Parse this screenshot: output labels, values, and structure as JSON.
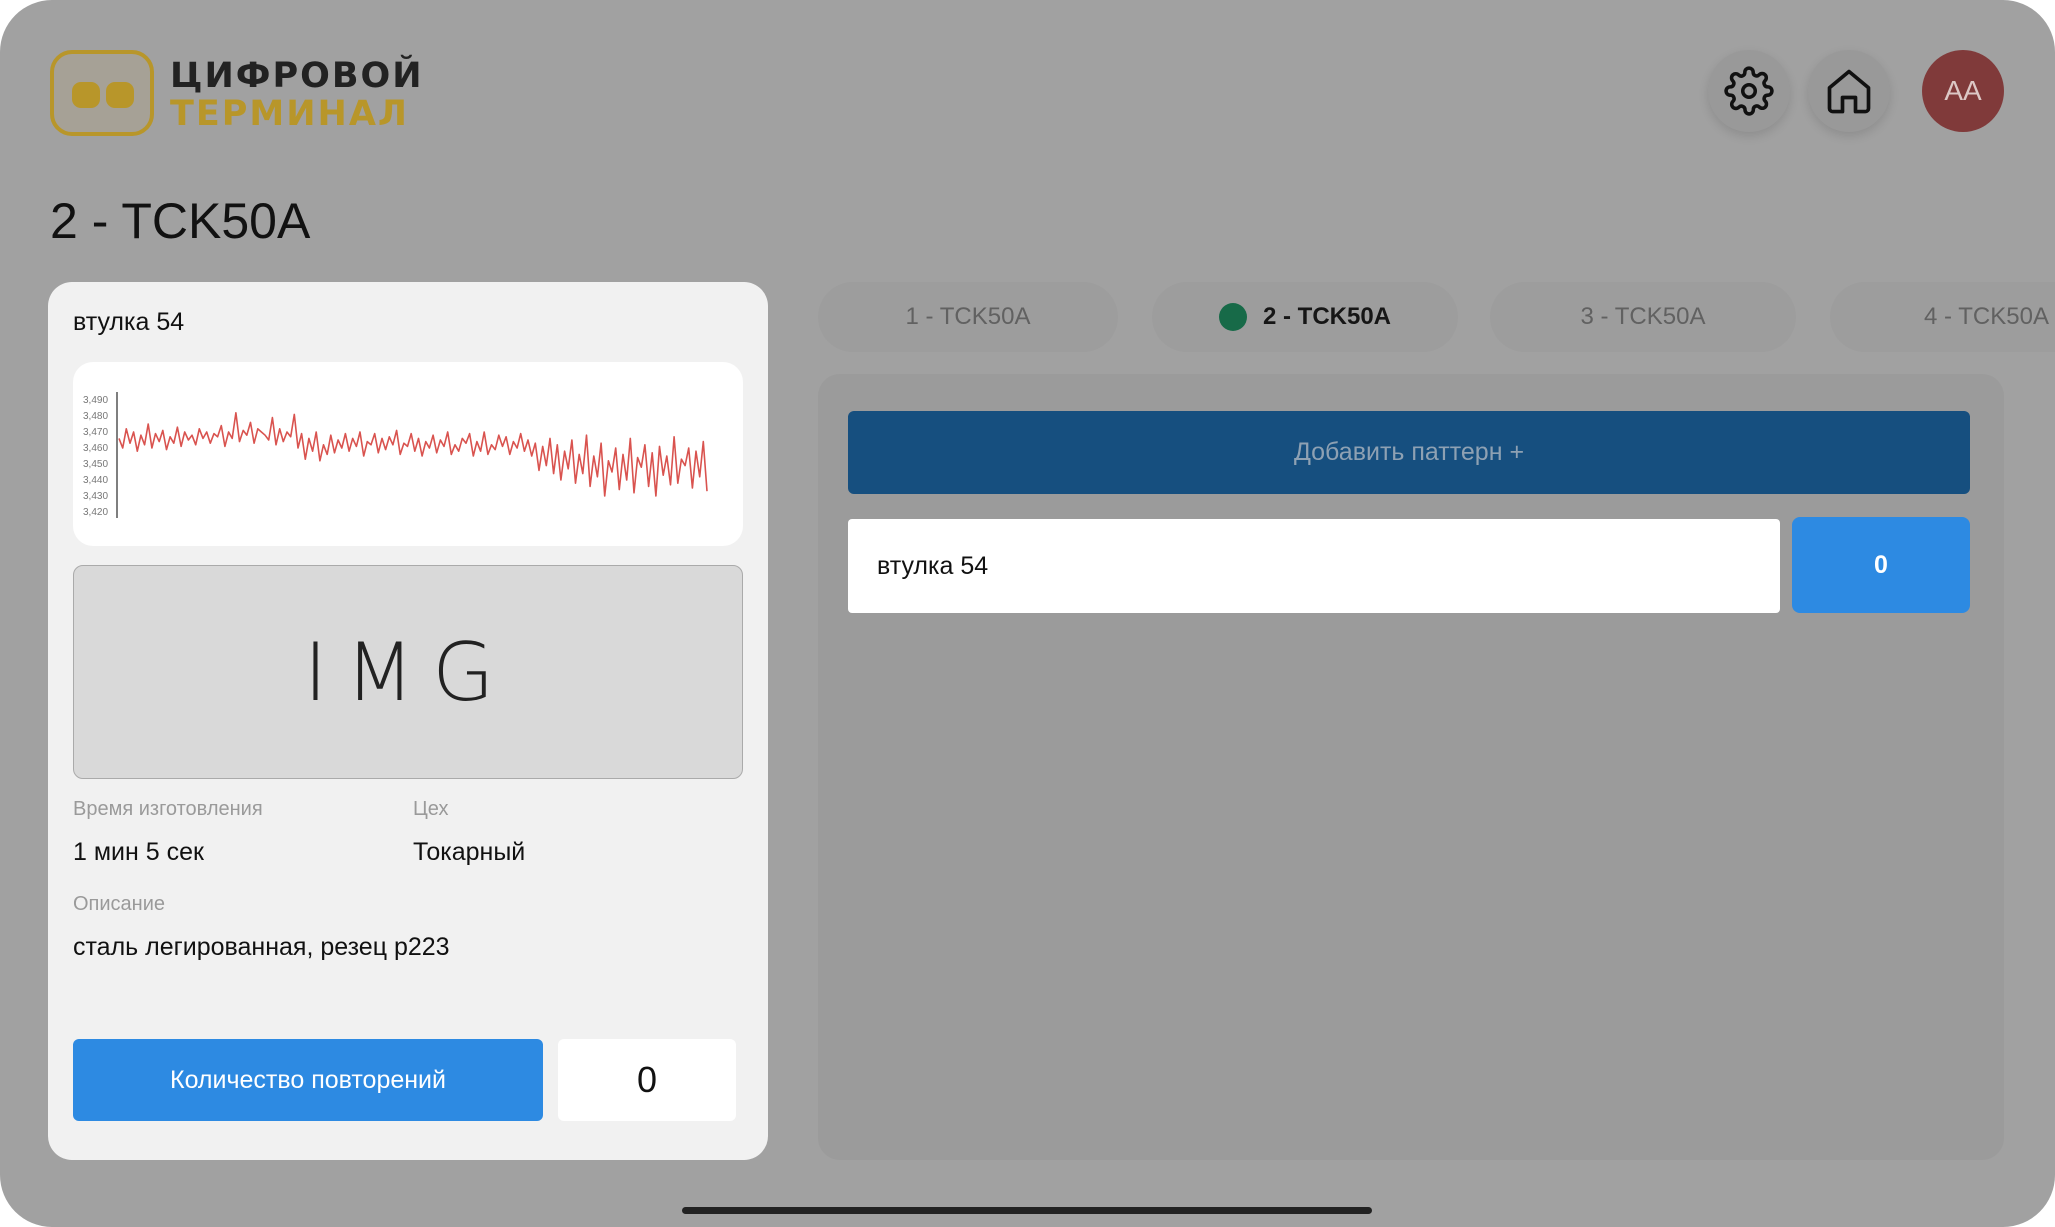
{
  "logo": {
    "line1": "ЦИФРОВОЙ",
    "line2": "ТЕРМИНАЛ"
  },
  "header": {
    "settings_icon": "gear-icon",
    "home_icon": "home-icon",
    "avatar_initials": "AA"
  },
  "page_title": "2 - TCK50A",
  "card": {
    "title": "втулка 54",
    "image_placeholder": "IMG",
    "time_label": "Время изготовления",
    "time_value": "1 мин 5 сек",
    "shop_label": "Цех",
    "shop_value": "Токарный",
    "description_label": "Описание",
    "description_value": "сталь легированная, резец р223",
    "repeat_button": "Количество повторений",
    "repeat_count": "0"
  },
  "chart_data": {
    "type": "line",
    "title": "",
    "xlabel": "",
    "ylabel": "",
    "ylim": [
      3420,
      3490
    ],
    "ticks": [
      "3,490",
      "3,480",
      "3,470",
      "3,460",
      "3,450",
      "3,440",
      "3,430",
      "3,420"
    ],
    "color": "#d9534f",
    "series": [
      {
        "values": [
          3466,
          3460,
          3472,
          3463,
          3470,
          3458,
          3468,
          3462,
          3475,
          3460,
          3469,
          3464,
          3471,
          3459,
          3467,
          3463,
          3473,
          3461,
          3470,
          3465,
          3468,
          3462,
          3472,
          3466,
          3470,
          3463,
          3469,
          3467,
          3474,
          3461,
          3470,
          3466,
          3482,
          3464,
          3471,
          3468,
          3476,
          3463,
          3472,
          3470,
          3468,
          3465,
          3479,
          3462,
          3472,
          3464,
          3470,
          3467,
          3481,
          3460,
          3469,
          3453,
          3466,
          3458,
          3470,
          3452,
          3462,
          3456,
          3468,
          3457,
          3465,
          3460,
          3469,
          3458,
          3466,
          3461,
          3470,
          3455,
          3464,
          3462,
          3469,
          3457,
          3466,
          3459,
          3467,
          3462,
          3471,
          3456,
          3463,
          3461,
          3469,
          3458,
          3466,
          3455,
          3464,
          3460,
          3468,
          3457,
          3465,
          3461,
          3470,
          3456,
          3462,
          3458,
          3466,
          3463,
          3469,
          3455,
          3464,
          3458,
          3470,
          3456,
          3462,
          3459,
          3468,
          3461,
          3467,
          3456,
          3464,
          3460,
          3469,
          3458,
          3465,
          3455,
          3463,
          3446,
          3461,
          3449,
          3466,
          3444,
          3462,
          3440,
          3458,
          3447,
          3465,
          3438,
          3456,
          3444,
          3468,
          3436,
          3455,
          3442,
          3463,
          3430,
          3452,
          3445,
          3460,
          3434,
          3456,
          3440,
          3466,
          3432,
          3454,
          3448,
          3462,
          3436,
          3457,
          3430,
          3461,
          3443,
          3455,
          3437,
          3467,
          3438,
          3453,
          3449,
          3460,
          3435,
          3458,
          3442,
          3464,
          3433
        ]
      }
    ]
  },
  "tabs": [
    {
      "label": "1 - TCK50A",
      "active": false
    },
    {
      "label": "2 - TCK50A",
      "active": true
    },
    {
      "label": "3 - TCK50A",
      "active": false
    },
    {
      "label": "4 - TCK50A",
      "active": false
    }
  ],
  "panel": {
    "add_button": "Добавить паттерн +",
    "patterns": [
      {
        "name": "втулка 54",
        "count": "0"
      }
    ]
  }
}
